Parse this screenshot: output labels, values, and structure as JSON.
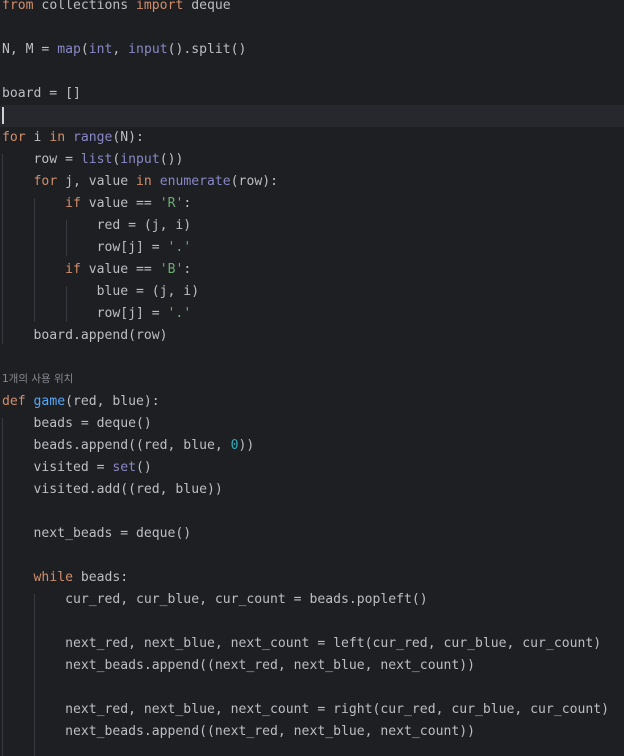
{
  "editor": {
    "usage_hint": "1개의 사용 위치",
    "lines": [
      [
        {
          "t": "from",
          "c": "kw"
        },
        {
          "t": " collections ",
          "c": "pl"
        },
        {
          "t": "import",
          "c": "kw"
        },
        {
          "t": " deque",
          "c": "pl"
        }
      ],
      [],
      [
        {
          "t": "N, M = ",
          "c": "pl"
        },
        {
          "t": "map",
          "c": "bi"
        },
        {
          "t": "(",
          "c": "pl"
        },
        {
          "t": "int",
          "c": "bi"
        },
        {
          "t": ", ",
          "c": "pl"
        },
        {
          "t": "input",
          "c": "bi"
        },
        {
          "t": "().split()",
          "c": "pl"
        }
      ],
      [],
      [
        {
          "t": "board = []",
          "c": "pl"
        }
      ],
      [],
      [
        {
          "t": "for",
          "c": "kw"
        },
        {
          "t": " i ",
          "c": "pl"
        },
        {
          "t": "in",
          "c": "kw"
        },
        {
          "t": " ",
          "c": "pl"
        },
        {
          "t": "range",
          "c": "bi"
        },
        {
          "t": "(N):",
          "c": "pl"
        }
      ],
      [
        {
          "t": "    row = ",
          "c": "pl"
        },
        {
          "t": "list",
          "c": "bi"
        },
        {
          "t": "(",
          "c": "pl"
        },
        {
          "t": "input",
          "c": "bi"
        },
        {
          "t": "())",
          "c": "pl"
        }
      ],
      [
        {
          "t": "    ",
          "c": "pl"
        },
        {
          "t": "for",
          "c": "kw"
        },
        {
          "t": " j, value ",
          "c": "pl"
        },
        {
          "t": "in",
          "c": "kw"
        },
        {
          "t": " ",
          "c": "pl"
        },
        {
          "t": "enumerate",
          "c": "bi"
        },
        {
          "t": "(row):",
          "c": "pl"
        }
      ],
      [
        {
          "t": "        ",
          "c": "pl"
        },
        {
          "t": "if",
          "c": "kw"
        },
        {
          "t": " value == ",
          "c": "pl"
        },
        {
          "t": "'R'",
          "c": "str"
        },
        {
          "t": ":",
          "c": "pl"
        }
      ],
      [
        {
          "t": "            red = (j, i)",
          "c": "pl"
        }
      ],
      [
        {
          "t": "            row[j] = ",
          "c": "pl"
        },
        {
          "t": "'.'",
          "c": "str"
        }
      ],
      [
        {
          "t": "        ",
          "c": "pl"
        },
        {
          "t": "if",
          "c": "kw"
        },
        {
          "t": " value == ",
          "c": "pl"
        },
        {
          "t": "'B'",
          "c": "str"
        },
        {
          "t": ":",
          "c": "pl"
        }
      ],
      [
        {
          "t": "            blue = (j, i)",
          "c": "pl"
        }
      ],
      [
        {
          "t": "            row[j] = ",
          "c": "pl"
        },
        {
          "t": "'.'",
          "c": "str"
        }
      ],
      [
        {
          "t": "    board.append(row)",
          "c": "pl"
        }
      ],
      [],
      [],
      [
        {
          "t": "def",
          "c": "kw"
        },
        {
          "t": " ",
          "c": "pl"
        },
        {
          "t": "game",
          "c": "fn"
        },
        {
          "t": "(red, blue):",
          "c": "pl"
        }
      ],
      [
        {
          "t": "    beads = deque()",
          "c": "pl"
        }
      ],
      [
        {
          "t": "    beads.append((red, blue, ",
          "c": "pl"
        },
        {
          "t": "0",
          "c": "num"
        },
        {
          "t": "))",
          "c": "pl"
        }
      ],
      [
        {
          "t": "    visited = ",
          "c": "pl"
        },
        {
          "t": "set",
          "c": "bi"
        },
        {
          "t": "()",
          "c": "pl"
        }
      ],
      [
        {
          "t": "    visited.add((red, blue))",
          "c": "pl"
        }
      ],
      [],
      [
        {
          "t": "    next_beads = deque()",
          "c": "pl"
        }
      ],
      [],
      [
        {
          "t": "    ",
          "c": "pl"
        },
        {
          "t": "while",
          "c": "kw"
        },
        {
          "t": " beads:",
          "c": "pl"
        }
      ],
      [
        {
          "t": "        cur_red, cur_blue, cur_count = beads.popleft()",
          "c": "pl"
        }
      ],
      [],
      [
        {
          "t": "        next_red, next_blue, next_count = left(cur_red, cur_blue, cur_count)",
          "c": "pl"
        }
      ],
      [
        {
          "t": "        next_beads.append((next_red, next_blue, next_count))",
          "c": "pl"
        }
      ],
      [],
      [
        {
          "t": "        next_red, next_blue, next_count = right(cur_red, cur_blue, cur_count)",
          "c": "pl"
        }
      ],
      [
        {
          "t": "        next_beads.append((next_red, next_blue, next_count))",
          "c": "pl"
        }
      ],
      []
    ]
  }
}
